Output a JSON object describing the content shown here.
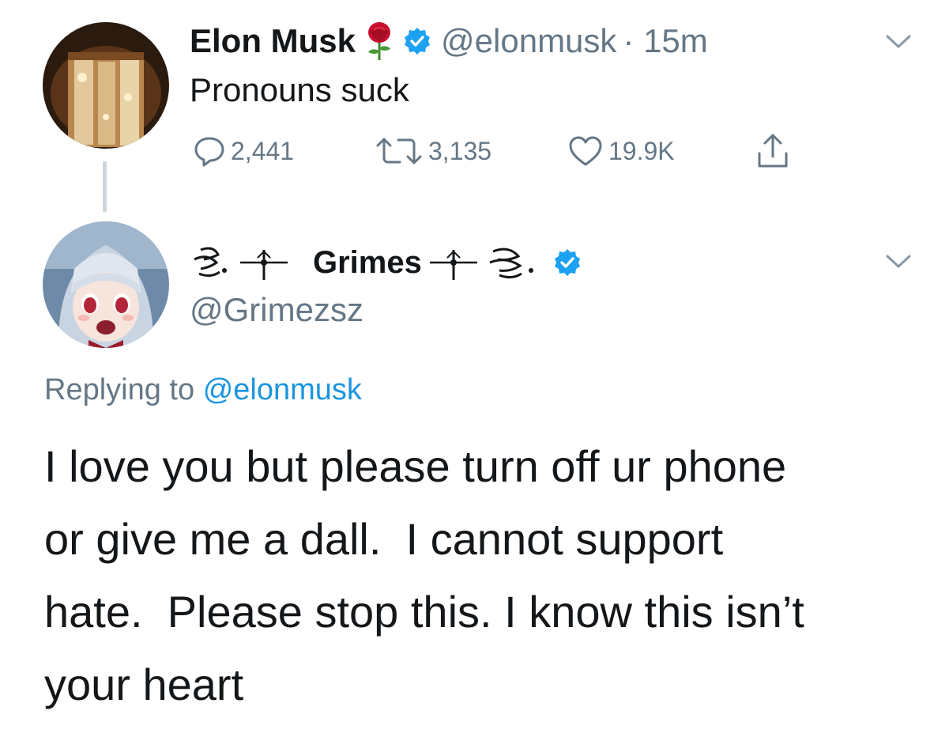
{
  "tweet1": {
    "display_name": "Elon Musk",
    "emoji_icon": "rose-icon",
    "handle": "@elonmusk",
    "time": "· 15m",
    "text": "Pronouns suck",
    "replies": "2,441",
    "retweets": "3,135",
    "likes": "19.9K"
  },
  "tweet2": {
    "display_name": "Grimes",
    "display_name_full": "꧁☬ G℟iḿes ☬꧂",
    "handle": "@Grimezsz",
    "replying_prefix": "Replying to",
    "replying_to": "@elonmusk",
    "body_lines": [
      "I love you but please turn off ur phone",
      "or give me a dall.  I cannot support",
      "hate.  Please stop this. I know this isn’t",
      "your heart"
    ]
  },
  "colors": {
    "verified": "#1da1f2",
    "secondary_text": "#657786",
    "link": "#1b95e0",
    "thread_line": "#ccd6dd"
  },
  "icons": [
    "reply-icon",
    "retweet-icon",
    "like-icon",
    "share-icon",
    "verified-badge-icon",
    "chevron-down-icon"
  ]
}
